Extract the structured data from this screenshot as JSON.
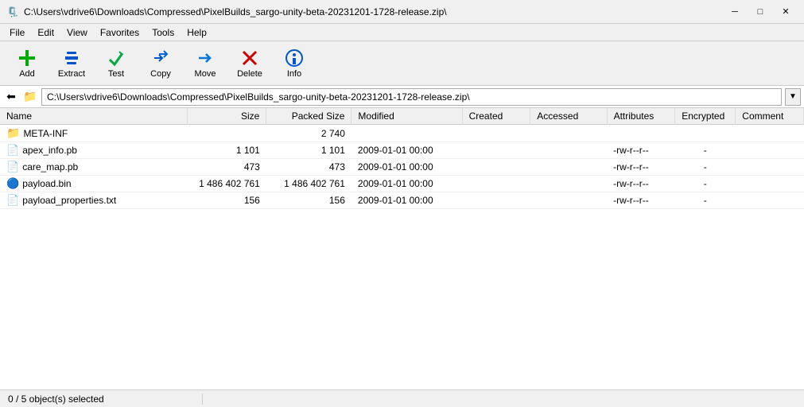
{
  "titlebar": {
    "title": "C:\\Users\\vdrive6\\Downloads\\Compressed\\PixelBuilds_sargo-unity-beta-20231201-1728-release.zip\\",
    "min_label": "─",
    "max_label": "□",
    "close_label": "✕"
  },
  "menubar": {
    "items": [
      "File",
      "Edit",
      "View",
      "Favorites",
      "Tools",
      "Help"
    ]
  },
  "toolbar": {
    "buttons": [
      {
        "id": "add",
        "label": "Add",
        "icon": "add"
      },
      {
        "id": "extract",
        "label": "Extract",
        "icon": "extract"
      },
      {
        "id": "test",
        "label": "Test",
        "icon": "test"
      },
      {
        "id": "copy",
        "label": "Copy",
        "icon": "copy"
      },
      {
        "id": "move",
        "label": "Move",
        "icon": "move"
      },
      {
        "id": "delete",
        "label": "Delete",
        "icon": "delete"
      },
      {
        "id": "info",
        "label": "Info",
        "icon": "info"
      }
    ]
  },
  "addressbar": {
    "path": "C:\\Users\\vdrive6\\Downloads\\Compressed\\PixelBuilds_sargo-unity-beta-20231201-1728-release.zip\\"
  },
  "table": {
    "columns": [
      "Name",
      "Size",
      "Packed Size",
      "Modified",
      "Created",
      "Accessed",
      "Attributes",
      "Encrypted",
      "Comment"
    ],
    "rows": [
      {
        "name": "META-INF",
        "type": "folder",
        "size": "",
        "packed_size": "2 740",
        "modified": "",
        "created": "",
        "accessed": "",
        "attributes": "",
        "encrypted": "",
        "comment": ""
      },
      {
        "name": "apex_info.pb",
        "type": "file",
        "size": "1 101",
        "packed_size": "1 101",
        "modified": "2009-01-01 00:00",
        "created": "",
        "accessed": "",
        "attributes": "-rw-r--r--",
        "encrypted": "-",
        "comment": ""
      },
      {
        "name": "care_map.pb",
        "type": "file",
        "size": "473",
        "packed_size": "473",
        "modified": "2009-01-01 00:00",
        "created": "",
        "accessed": "",
        "attributes": "-rw-r--r--",
        "encrypted": "-",
        "comment": ""
      },
      {
        "name": "payload.bin",
        "type": "bin",
        "size": "1 486 402 761",
        "packed_size": "1 486 402 761",
        "modified": "2009-01-01 00:00",
        "created": "",
        "accessed": "",
        "attributes": "-rw-r--r--",
        "encrypted": "-",
        "comment": ""
      },
      {
        "name": "payload_properties.txt",
        "type": "file",
        "size": "156",
        "packed_size": "156",
        "modified": "2009-01-01 00:00",
        "created": "",
        "accessed": "",
        "attributes": "-rw-r--r--",
        "encrypted": "-",
        "comment": ""
      }
    ]
  },
  "statusbar": {
    "sections": [
      "0 / 5 object(s) selected",
      "",
      "",
      ""
    ]
  }
}
